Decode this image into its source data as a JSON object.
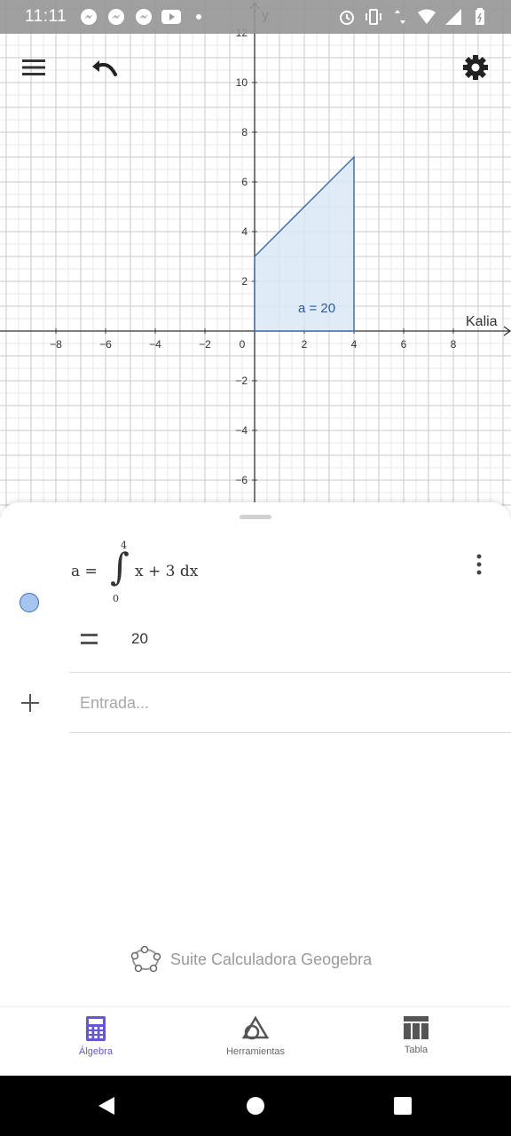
{
  "status_bar": {
    "time": "11:11",
    "left_icons": [
      "messenger-icon",
      "messenger-icon",
      "messenger-icon",
      "youtube-icon",
      "dot-icon"
    ],
    "right_icons": [
      "alarm-icon",
      "vibrate-icon",
      "data-arrows-icon",
      "wifi-icon",
      "signal-icon",
      "battery-icon"
    ]
  },
  "toolbar": {
    "menu_icon": "hamburger-menu-icon",
    "undo_icon": "undo-icon",
    "settings_icon": "gear-icon"
  },
  "graph": {
    "y_axis_label": "y",
    "x_axis_label": "Kalia",
    "x_ticks": [
      "−8",
      "−6",
      "−4",
      "−2",
      "0",
      "2",
      "4",
      "6",
      "8"
    ],
    "y_ticks": [
      "12",
      "10",
      "8",
      "6",
      "4",
      "2",
      "−2",
      "−4",
      "−6"
    ],
    "region_label": "a = 20",
    "region": {
      "function": "x + 3",
      "from": 0,
      "to": 4
    },
    "colors": {
      "region_fill": "#dbe7f7",
      "region_stroke": "#3f6fb0",
      "region_label": "#2a5aa0"
    }
  },
  "algebra": {
    "entry": {
      "lhs": "a =",
      "upper_limit": "4",
      "lower_limit": "0",
      "integrand": "x + 3 dx",
      "result_sign": "=",
      "result": "20",
      "color": "#a5c4ef"
    },
    "input_placeholder": "Entrada..."
  },
  "suite_link": {
    "label": "Suite Calculadora Geogebra"
  },
  "bottom_nav": {
    "tabs": [
      {
        "label": "Álgebra",
        "icon": "calculator-icon",
        "active": true
      },
      {
        "label": "Herramientas",
        "icon": "shapes-icon",
        "active": false
      },
      {
        "label": "Tabla",
        "icon": "table-icon",
        "active": false
      }
    ],
    "accent": "#6557d2"
  },
  "system_nav": [
    "back-icon",
    "home-icon",
    "recents-icon"
  ]
}
